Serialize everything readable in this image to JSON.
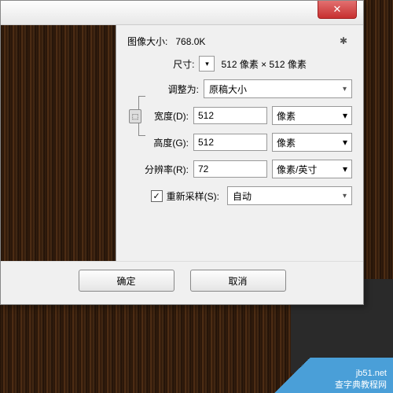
{
  "titlebar": {
    "close": "✕"
  },
  "labels": {
    "imageSize": "图像大小:",
    "imageSizeVal": "768.0K",
    "dimensions": "尺寸:",
    "dimensionsVal": "512 像素 × 512 像素",
    "adjustTo": "调整为:",
    "width": "宽度(D):",
    "height": "高度(G):",
    "resolution": "分辨率(R):",
    "resample": "重新采样(S):"
  },
  "values": {
    "preset": "原稿大小",
    "width": "512",
    "height": "512",
    "resolution": "72",
    "unitPx": "像素",
    "unitRes": "像素/英寸",
    "resampleMethod": "自动"
  },
  "buttons": {
    "ok": "确定",
    "cancel": "取消"
  },
  "watermark": {
    "line1": "jb51.net",
    "line2": "查字典教程网"
  },
  "icons": {
    "gear": "✱",
    "arrow": "▾",
    "check": "✓",
    "link": "⬚"
  }
}
